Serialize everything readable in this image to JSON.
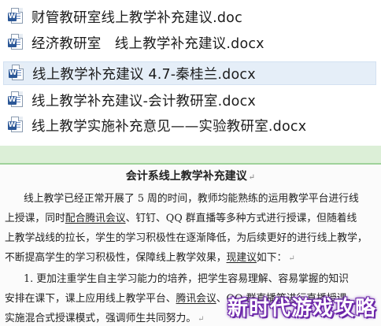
{
  "files": [
    {
      "name": "财管教研室线上教学补充建议.doc",
      "icon": "word-document-icon",
      "selected": false
    },
    {
      "name": "经济教研室   线上教学补充建议.docx",
      "icon": "word-document-icon",
      "selected": false
    },
    {
      "name": "线上教学补充建议 4.7-秦桂兰.docx",
      "icon": "word-document-icon",
      "selected": true
    },
    {
      "name": "线上教学补充建议-会计教研室.docx",
      "icon": "word-document-icon",
      "selected": false
    },
    {
      "name": "线上教学实施补充意见——实验教研室.docx",
      "icon": "word-document-icon",
      "selected": false
    }
  ],
  "document": {
    "title": "会计系线上教学补充建议",
    "lines": [
      {
        "parts": [
          "线上教学已经正常开展了 5 周的时间，教师均能熟练的运用教学平台进行线"
        ]
      },
      {
        "parts": [
          "上授课，同时",
          "配合腾讯会议",
          "、钉钉、QQ 群直播等多种方式进行授课，但随着线"
        ]
      },
      {
        "parts": [
          "上教学战线的拉长，学生的学习积极性在逐渐降低，为后续更好的进行线上教学，"
        ]
      },
      {
        "parts": [
          "不断提高学生的学习积极性，保障线上教学效果，",
          "现建议",
          "如下："
        ]
      },
      {
        "parts": [
          "1.  更加注重学生自主学习能力的培养，把学生容易理解、容易掌握的知识"
        ]
      },
      {
        "parts": [
          "安排在课下，课上应用线上教学平台、",
          "腾讯会议",
          "、QQ 群直播等进行直播授课，"
        ]
      },
      {
        "parts": [
          "实施混合式授课模式，强调师生共同努力。"
        ]
      }
    ]
  },
  "watermark": "新时代游戏攻略",
  "colors": {
    "selection": "#e5eef8",
    "band": "#dcefd7",
    "word_blue": "#2b5797"
  }
}
